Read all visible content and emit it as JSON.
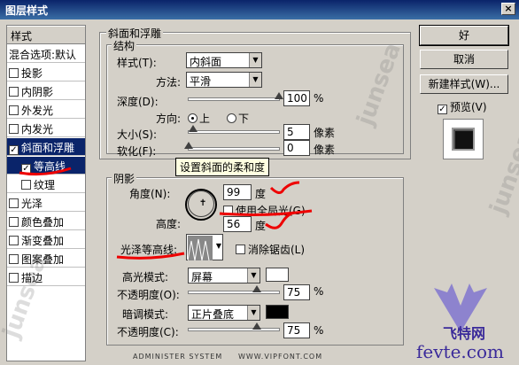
{
  "window": {
    "title": "图层样式",
    "close": "×"
  },
  "left": {
    "header": "样式",
    "items": [
      {
        "label": "混合选项:默认",
        "check": false,
        "cb": false
      },
      {
        "label": "投影",
        "cb": true,
        "check": false
      },
      {
        "label": "内阴影",
        "cb": true,
        "check": false
      },
      {
        "label": "外发光",
        "cb": true,
        "check": false
      },
      {
        "label": "内发光",
        "cb": true,
        "check": false
      },
      {
        "label": "斜面和浮雕",
        "cb": true,
        "check": true
      },
      {
        "label": "等高线",
        "cb": true,
        "check": true
      },
      {
        "label": "纹理",
        "cb": true,
        "check": false
      },
      {
        "label": "光泽",
        "cb": true,
        "check": false
      },
      {
        "label": "颜色叠加",
        "cb": true,
        "check": false
      },
      {
        "label": "渐变叠加",
        "cb": true,
        "check": false
      },
      {
        "label": "图案叠加",
        "cb": true,
        "check": false
      },
      {
        "label": "描边",
        "cb": true,
        "check": false
      }
    ]
  },
  "bevel": {
    "group": "斜面和浮雕",
    "structure": "结构",
    "style_label": "样式(T):",
    "style_value": "内斜面",
    "method_label": "方法:",
    "method_value": "平滑",
    "depth_label": "深度(D):",
    "depth_value": "100",
    "depth_unit": "%",
    "depth_pos": 1.0,
    "dir_label": "方向:",
    "dir_up": "上",
    "dir_down": "下",
    "size_label": "大小(S):",
    "size_value": "5",
    "size_unit": "像素",
    "size_pos": 0.05,
    "soften_label": "软化(F):",
    "soften_value": "0",
    "soften_unit": "像素",
    "soften_pos": 0.0,
    "tooltip": "设置斜面的柔和度"
  },
  "shading": {
    "group": "阴影",
    "angle_label": "角度(N):",
    "angle_value": "99",
    "angle_unit": "度",
    "global_light": "使用全局光(G)",
    "altitude_label": "高度:",
    "altitude_value": "56",
    "altitude_unit": "度",
    "gloss_label": "光泽等高线:",
    "antialias": "消除锯齿(L)",
    "highlight_label": "高光模式:",
    "highlight_mode": "屏幕",
    "highlight_color": "#ffffff",
    "opacity1_label": "不透明度(O):",
    "opacity1_value": "75",
    "opacity1_pos": 0.75,
    "shadow_label": "暗调模式:",
    "shadow_mode": "正片叠底",
    "shadow_color": "#000000",
    "opacity2_label": "不透明度(C):",
    "opacity2_value": "75",
    "opacity2_pos": 0.75,
    "pct": "%"
  },
  "buttons": {
    "ok": "好",
    "cancel": "取消",
    "new_style": "新建样式(W)...",
    "preview": "预览(V)"
  },
  "watermark": {
    "site": "ADMINISTER SYSTEM",
    "url": "WWW.VIPFONT.COM",
    "brand": "飞特网",
    "domain": "fevte.com",
    "side": "junsea"
  }
}
